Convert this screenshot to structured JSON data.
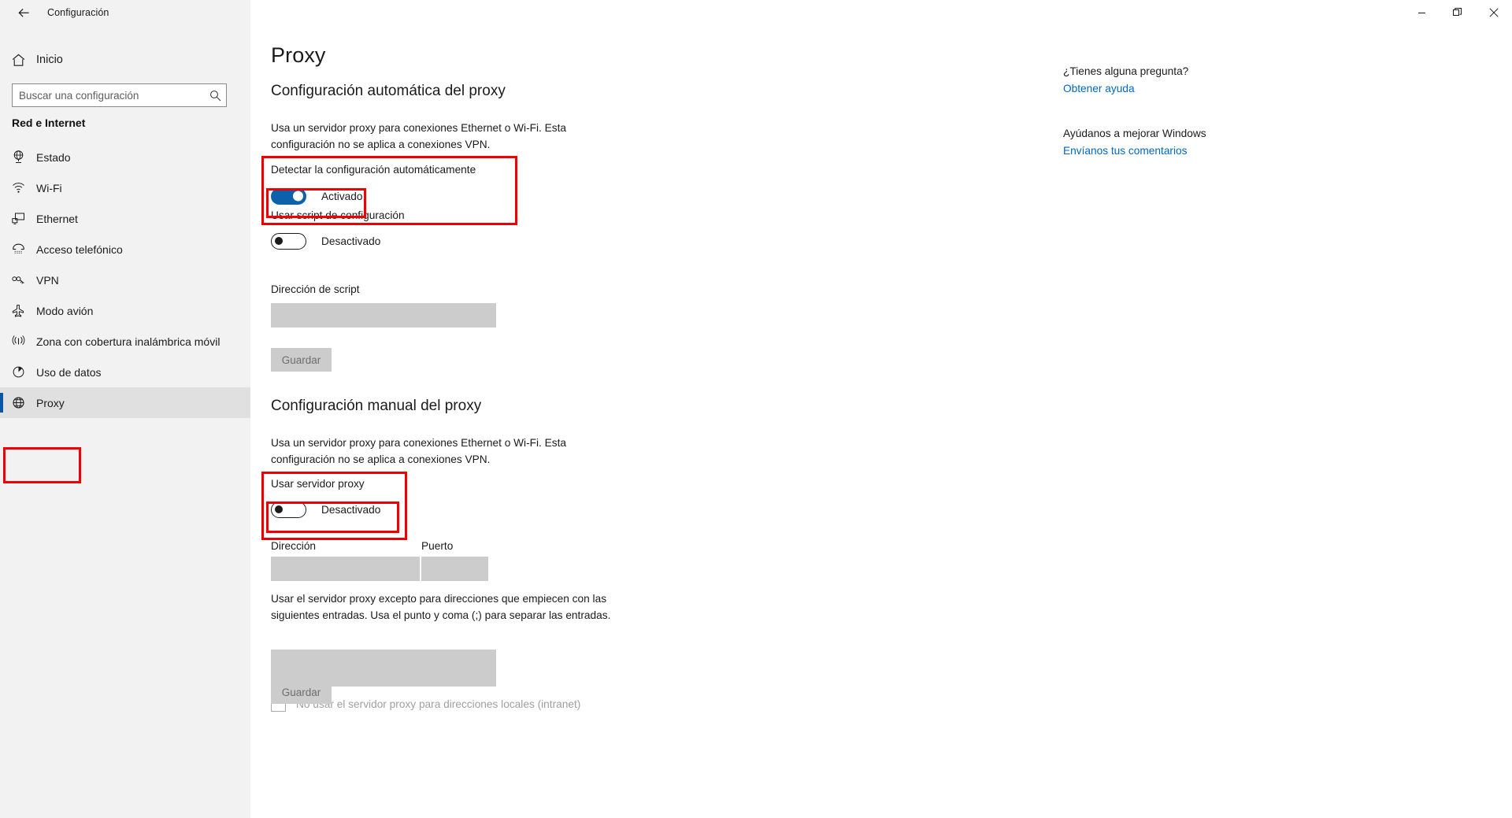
{
  "window": {
    "title": "Configuración",
    "back_icon": "back-arrow-icon",
    "controls": {
      "minimize": "minimize-icon",
      "restore": "restore-icon",
      "close": "close-icon"
    }
  },
  "sidebar": {
    "home": {
      "label": "Inicio",
      "icon": "home-icon"
    },
    "search": {
      "placeholder": "Buscar una configuración",
      "value": "",
      "icon": "search-icon"
    },
    "group_title": "Red e Internet",
    "items": [
      {
        "label": "Estado",
        "icon": "globe-status-icon",
        "selected": false
      },
      {
        "label": "Wi-Fi",
        "icon": "wifi-icon",
        "selected": false
      },
      {
        "label": "Ethernet",
        "icon": "ethernet-icon",
        "selected": false
      },
      {
        "label": "Acceso telefónico",
        "icon": "dialup-phone-icon",
        "selected": false
      },
      {
        "label": "VPN",
        "icon": "vpn-icon",
        "selected": false
      },
      {
        "label": "Modo avión",
        "icon": "airplane-icon",
        "selected": false
      },
      {
        "label": "Zona con cobertura inalámbrica móvil",
        "icon": "hotspot-icon",
        "selected": false
      },
      {
        "label": "Uso de datos",
        "icon": "data-usage-pie-icon",
        "selected": false
      },
      {
        "label": "Proxy",
        "icon": "proxy-globe-icon",
        "selected": true
      }
    ]
  },
  "main": {
    "page_title": "Proxy",
    "auto_section": {
      "heading": "Configuración automática del proxy",
      "description": "Usa un servidor proxy para conexiones Ethernet o Wi-Fi. Esta configuración no se aplica a conexiones VPN.",
      "detect_label": "Detectar la configuración automáticamente",
      "detect_state": "Activado",
      "detect_on": true,
      "script_label": "Usar script de configuración",
      "script_state": "Desactivado",
      "script_on": false,
      "script_address_label": "Dirección de script",
      "script_address_value": "",
      "save_label": "Guardar"
    },
    "manual_section": {
      "heading": "Configuración manual del proxy",
      "description": "Usa un servidor proxy para conexiones Ethernet o Wi-Fi. Esta configuración no se aplica a conexiones VPN.",
      "use_proxy_label": "Usar servidor proxy",
      "use_proxy_state": "Desactivado",
      "use_proxy_on": false,
      "address_label": "Dirección",
      "address_value": "",
      "port_label": "Puerto",
      "port_value": "",
      "exceptions_description": "Usar el servidor proxy excepto para direcciones que empiecen con las siguientes entradas. Usa el punto y coma (;) para separar las entradas.",
      "exceptions_value": "",
      "local_checkbox_label": "No usar el servidor proxy para direcciones locales (intranet)",
      "local_checkbox_checked": false,
      "save_label": "Guardar"
    }
  },
  "help_panel": {
    "question_title": "¿Tienes alguna pregunta?",
    "question_link": "Obtener ayuda",
    "feedback_title": "Ayúdanos a mejorar Windows",
    "feedback_link": "Envíanos tus comentarios"
  },
  "colors": {
    "accent_blue": "#0d61ab",
    "link_blue": "#0067c0",
    "highlight_red": "#ef0000",
    "sidebar_bg": "#f2f2f2",
    "disabled_field": "#cccccc"
  }
}
